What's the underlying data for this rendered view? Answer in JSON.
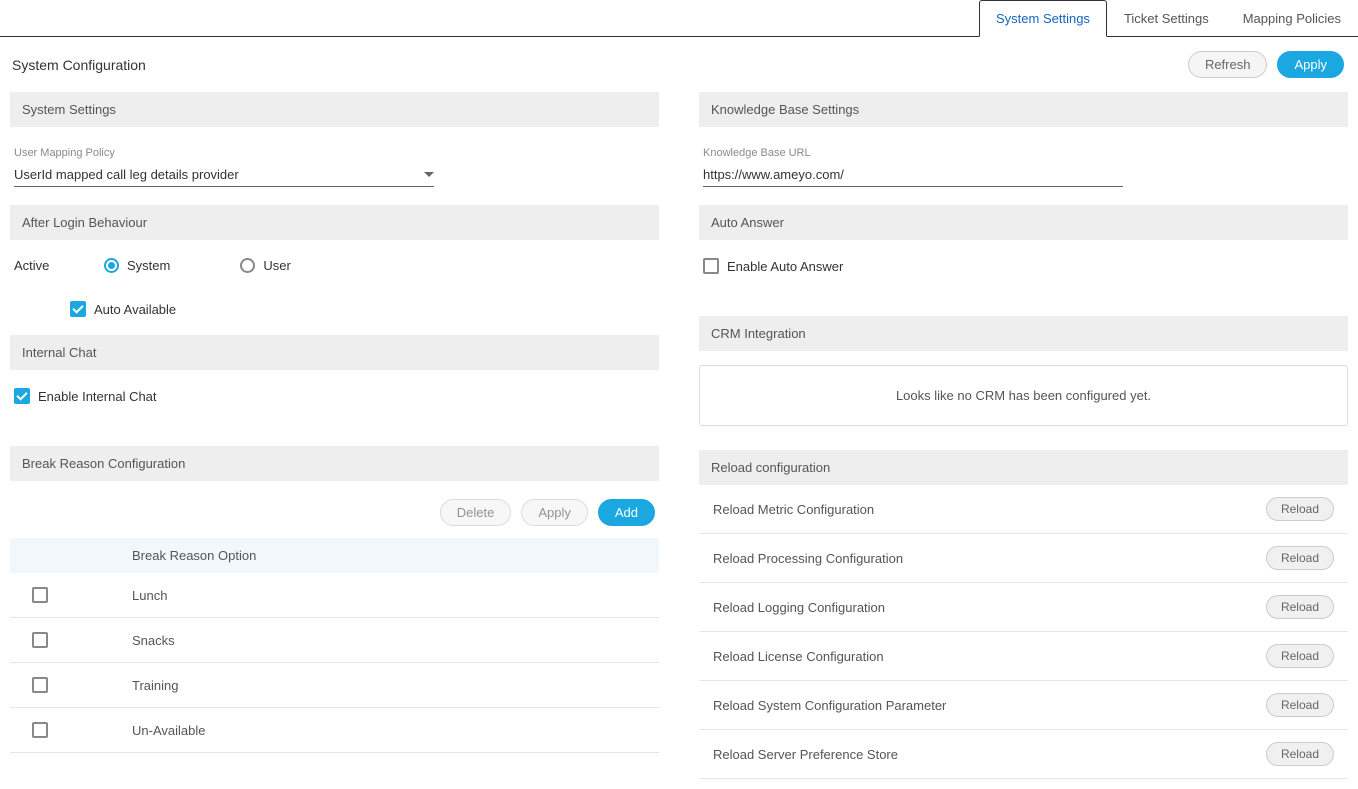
{
  "tabs": {
    "system": "System Settings",
    "ticket": "Ticket Settings",
    "mapping": "Mapping Policies"
  },
  "page": {
    "title": "System Configuration",
    "refresh": "Refresh",
    "apply": "Apply"
  },
  "left": {
    "system_settings_header": "System Settings",
    "user_mapping_label": "User Mapping Policy",
    "user_mapping_value": "UserId mapped call leg details provider",
    "after_login_header": "After Login Behaviour",
    "active_label": "Active",
    "radio_system": "System",
    "radio_user": "User",
    "auto_available": "Auto Available",
    "internal_chat_header": "Internal Chat",
    "enable_internal_chat": "Enable Internal Chat",
    "break_header": "Break Reason Configuration",
    "break_delete": "Delete",
    "break_apply": "Apply",
    "break_add": "Add",
    "break_table_header": "Break Reason Option",
    "break_rows": [
      "Lunch",
      "Snacks",
      "Training",
      "Un-Available"
    ]
  },
  "right": {
    "kb_header": "Knowledge Base Settings",
    "kb_url_label": "Knowledge Base URL",
    "kb_url_value": "https://www.ameyo.com/",
    "auto_answer_header": "Auto Answer",
    "enable_auto_answer": "Enable Auto Answer",
    "crm_header": "CRM Integration",
    "crm_empty": "Looks like no CRM has been configured yet.",
    "reload_header": "Reload configuration",
    "reload_label": "Reload",
    "reload_rows": [
      "Reload Metric Configuration",
      "Reload Processing Configuration",
      "Reload Logging Configuration",
      "Reload License Configuration",
      "Reload System Configuration Parameter",
      "Reload Server Preference Store"
    ]
  }
}
